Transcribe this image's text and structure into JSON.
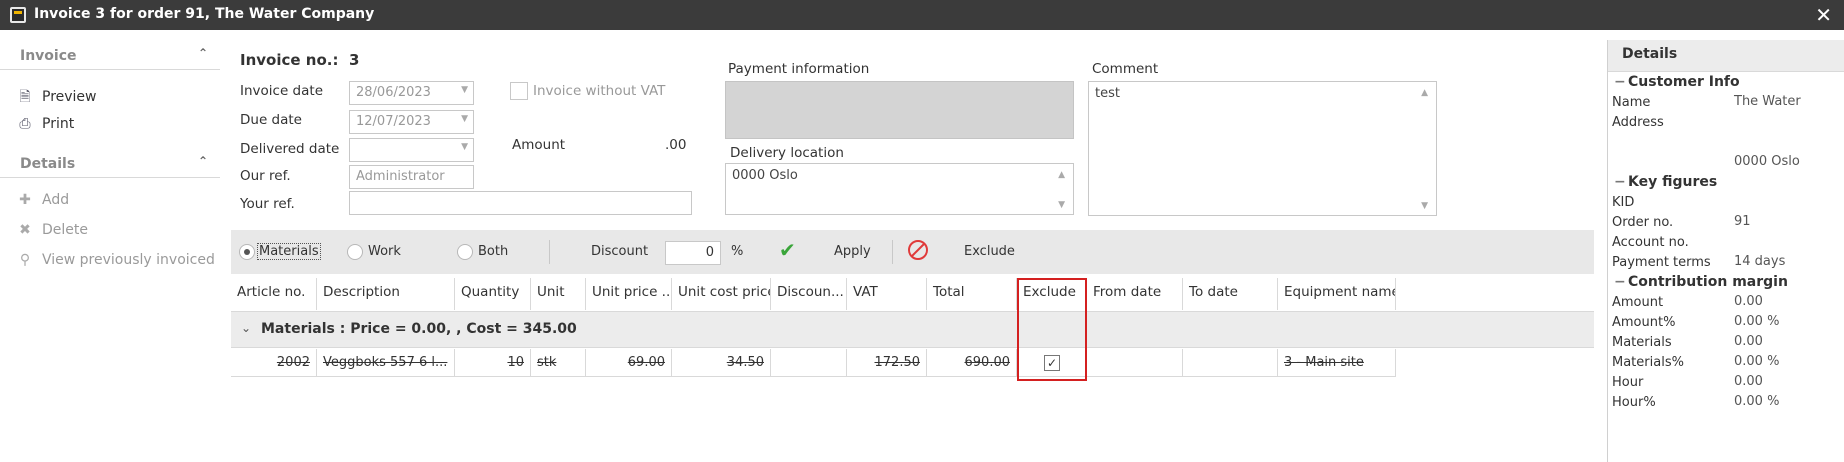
{
  "window": {
    "title": "Invoice 3 for order 91, The Water Company",
    "close_icon": "close-icon"
  },
  "left_panel": {
    "invoice_group": {
      "title": "Invoice",
      "items": [
        "Preview",
        "Print"
      ]
    },
    "details_group": {
      "title": "Details",
      "items": [
        "Add",
        "Delete",
        "View previously invoiced"
      ]
    }
  },
  "form": {
    "invoice_no_label": "Invoice no.:",
    "invoice_no_value": "3",
    "invoice_date_label": "Invoice date",
    "invoice_date_value": "28/06/2023",
    "due_date_label": "Due date",
    "due_date_value": "12/07/2023",
    "delivered_date_label": "Delivered date",
    "delivered_date_value": "",
    "our_ref_label": "Our ref.",
    "our_ref_value": "Administrator",
    "your_ref_label": "Your ref.",
    "your_ref_value": "",
    "without_vat_label": "Invoice without VAT",
    "amount_label": "Amount",
    "amount_value": ".00",
    "payment_info_label": "Payment information",
    "delivery_location_label": "Delivery location",
    "delivery_location_value": "0000 Oslo",
    "comment_label": "Comment",
    "comment_value": "test"
  },
  "toolbar": {
    "materials_label": "Materials",
    "work_label": "Work",
    "both_label": "Both",
    "discount_label": "Discount",
    "discount_value": "0",
    "percent_label": "%",
    "apply_label": "Apply",
    "exclude_label": "Exclude",
    "selected": "Materials"
  },
  "grid": {
    "columns": [
      "Article no.",
      "Description",
      "Quantity",
      "Unit",
      "Unit price ...",
      "Unit cost price",
      "Discoun...",
      "VAT",
      "Total",
      "Exclude",
      "From date",
      "To date",
      "Equipment name"
    ],
    "group_label": "Materials : Price = 0.00, , Cost = 345.00",
    "rows": [
      {
        "article_no": "2002",
        "description": "Veggboks 557 6 l...",
        "quantity": "10",
        "unit": "stk",
        "unit_price": "69.00",
        "unit_cost_price": "34.50",
        "discount": "",
        "vat": "172.50",
        "total": "690.00",
        "exclude": true,
        "from_date": "",
        "to_date": "",
        "equipment_name": "3 - Main site"
      }
    ]
  },
  "details_panel": {
    "title": "Details",
    "customer_info": {
      "title": "Customer Info",
      "name_label": "Name",
      "name_value": "The Water",
      "address_label": "Address",
      "address_value": "0000 Oslo"
    },
    "key_figures": {
      "title": "Key figures",
      "kid_label": "KID",
      "kid_value": "",
      "order_no_label": "Order no.",
      "order_no_value": "91",
      "account_no_label": "Account no.",
      "account_no_value": "",
      "payment_terms_label": "Payment terms",
      "payment_terms_value": "14 days"
    },
    "contribution_margin": {
      "title": "Contribution margin",
      "rows": [
        {
          "label": "Amount",
          "value": "0.00"
        },
        {
          "label": "Amount%",
          "value": "0.00 %"
        },
        {
          "label": "Materials",
          "value": "0.00"
        },
        {
          "label": "Materials%",
          "value": "0.00 %"
        },
        {
          "label": "Hour",
          "value": "0.00"
        },
        {
          "label": "Hour%",
          "value": "0.00 %"
        }
      ]
    }
  },
  "colors": {
    "titlebar": "#3b3b3b",
    "apply_check": "#3aa53a",
    "exclude_icon": "#e03a3a",
    "highlight_border": "#d42020"
  }
}
